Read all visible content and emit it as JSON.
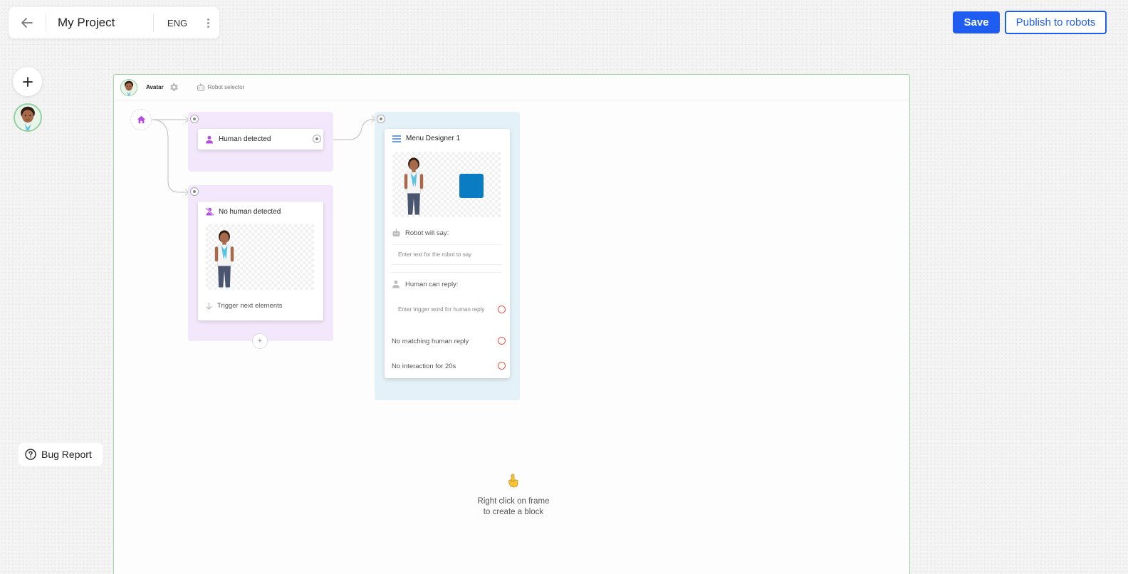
{
  "header": {
    "title": "My Project",
    "language": "ENG"
  },
  "actions": {
    "save_label": "Save",
    "publish_label": "Publish to robots"
  },
  "sidebar": {
    "bug_report_label": "Bug Report"
  },
  "frame": {
    "avatar_label": "Avatar",
    "robot_selector_label": "Robot selector"
  },
  "blocks": {
    "human_detected": {
      "title": "Human detected"
    },
    "no_human_detected": {
      "title": "No human detected",
      "trigger_label": "Trigger next elements"
    },
    "menu_designer": {
      "title": "Menu Designer 1",
      "robot_say_label": "Robot will say:",
      "robot_say_placeholder": "Enter text for the robot to say",
      "human_reply_label": "Human can reply:",
      "human_reply_placeholder": "Enter trigger word for human reply",
      "no_match_label": "No matching human reply",
      "no_interaction_label": "No interaction for 20s"
    }
  },
  "canvas_hint": {
    "line1": "Right click on frame",
    "line2": "to create a block"
  },
  "colors": {
    "primary": "#1f5cf0",
    "frame_border": "#9ed6a6",
    "trigger_group": "#f3e8fb",
    "menu_group": "#e4f1f8",
    "trigger_icon": "#b44ee0",
    "menu_icon": "#3a7fd4",
    "blue_square": "#0a7cc4",
    "port_red": "#e8574a"
  },
  "icons": {
    "back": "arrow-left-icon",
    "more": "kebab-icon",
    "add": "plus-icon",
    "help": "question-circle-icon",
    "gear": "gear-icon",
    "robot": "robot-icon",
    "home": "home-icon",
    "person": "person-icon",
    "person_off": "person-off-icon",
    "menu": "menu-lines-icon",
    "arrow_down": "arrow-down-icon",
    "pointer": "pointing-hand-icon"
  }
}
